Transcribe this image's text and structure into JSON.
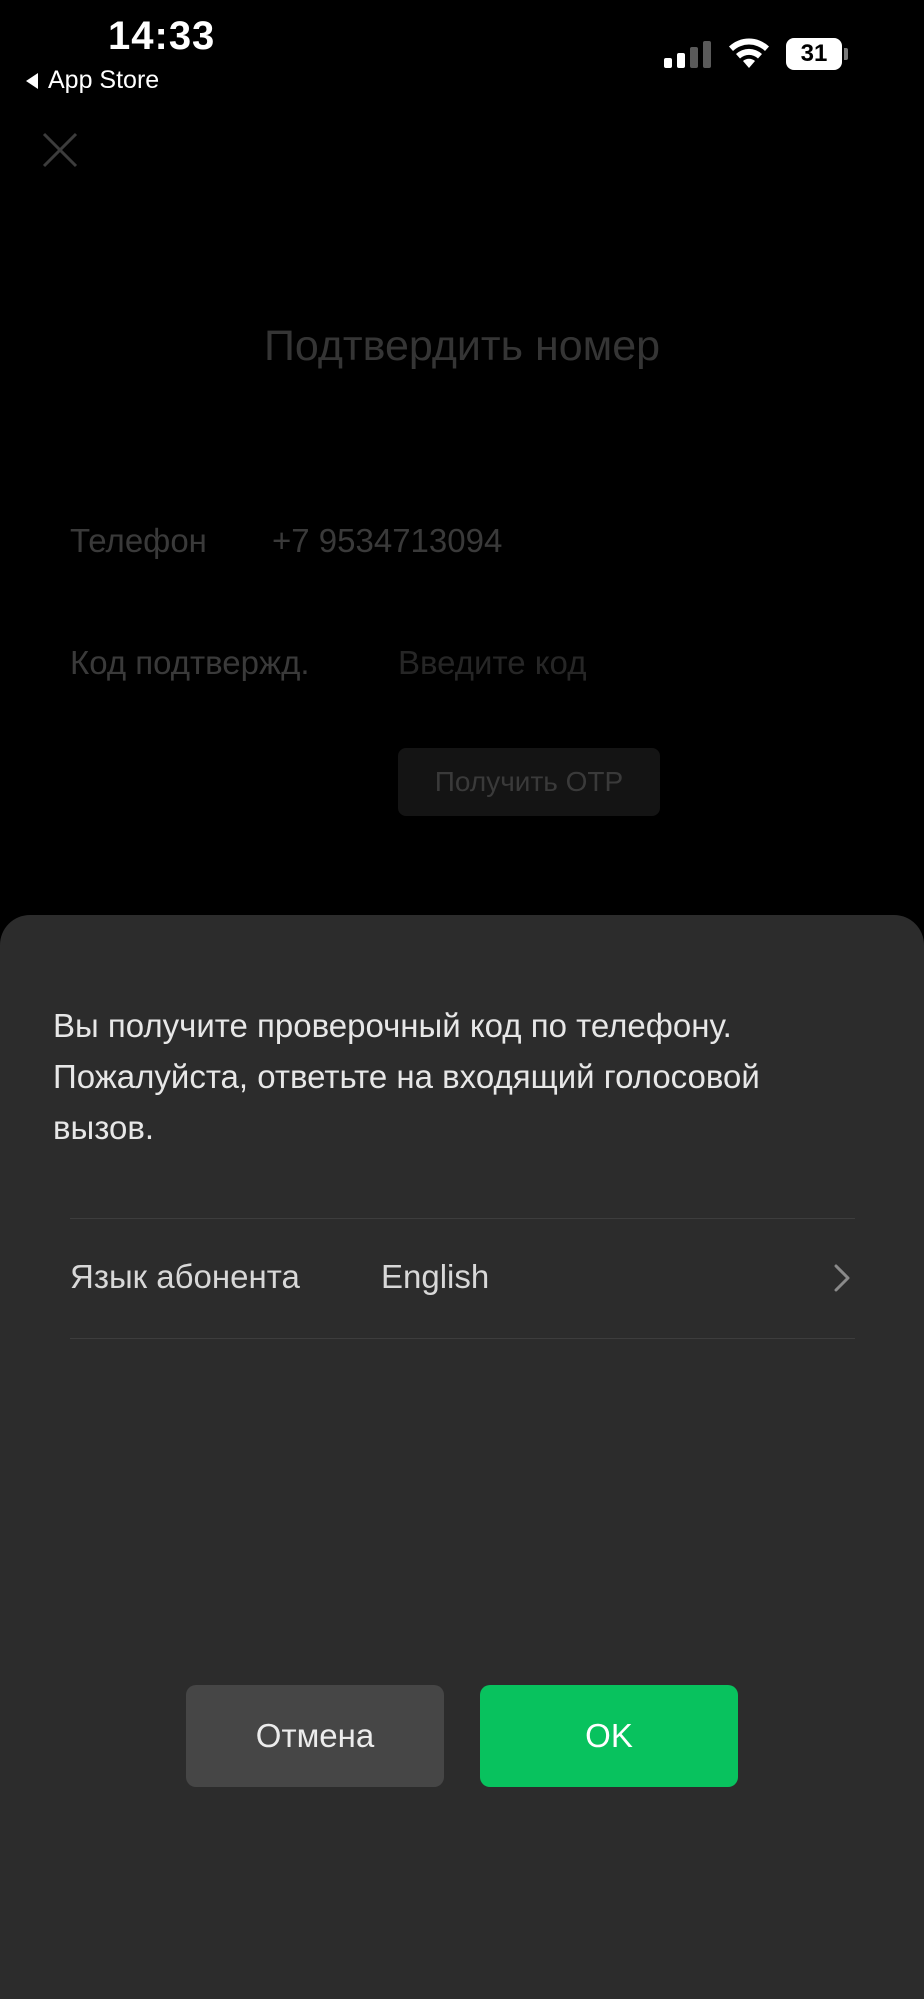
{
  "status_bar": {
    "time": "14:33",
    "back_app": "App Store",
    "battery": "31"
  },
  "background": {
    "title": "Подтвердить номер",
    "phone_label": "Телефон",
    "phone_value": "+7 9534713094",
    "code_label": "Код подтвержд.",
    "code_placeholder": "Введите код",
    "otp_button": "Получить OTP"
  },
  "sheet": {
    "message_lines": [
      "Вы получите проверочный код по телефону.",
      "Пожалуйста, ответьте на входящий голосовой",
      "вызов."
    ],
    "language_label": "Язык абонента",
    "language_value": "English",
    "cancel_label": "Отмена",
    "ok_label": "OK"
  },
  "colors": {
    "accent": "#08c25e",
    "sheet_bg": "#2c2c2c",
    "cancel_bg": "#464646"
  }
}
